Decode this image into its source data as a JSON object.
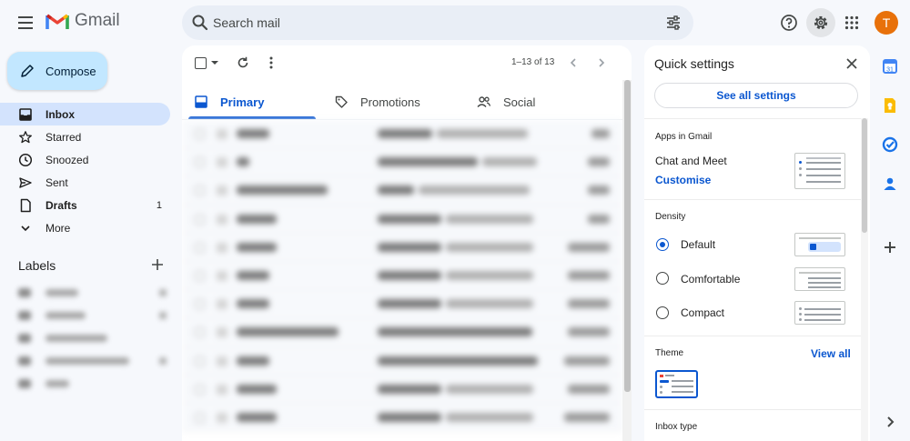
{
  "app": {
    "name": "Gmail"
  },
  "search": {
    "placeholder": "Search mail"
  },
  "account": {
    "initial": "T",
    "color": "#e8710a"
  },
  "colors": {
    "accent": "#0b57d0",
    "compose_bg": "#c2e7ff",
    "selected_nav": "#d3e3fd"
  },
  "compose": {
    "label": "Compose"
  },
  "nav": {
    "items": [
      {
        "label": "Inbox",
        "icon": "inbox-icon",
        "active": true
      },
      {
        "label": "Starred",
        "icon": "star-icon"
      },
      {
        "label": "Snoozed",
        "icon": "clock-icon"
      },
      {
        "label": "Sent",
        "icon": "send-icon"
      },
      {
        "label": "Drafts",
        "icon": "draft-icon",
        "count": "1"
      },
      {
        "label": "More",
        "icon": "chevron-down-icon"
      }
    ]
  },
  "labels": {
    "heading": "Labels"
  },
  "mail": {
    "pager": "1–13 of 13",
    "tabs": [
      {
        "label": "Primary",
        "icon": "inbox-tab-icon",
        "active": true
      },
      {
        "label": "Promotions",
        "icon": "tag-icon"
      },
      {
        "label": "Social",
        "icon": "people-icon"
      }
    ]
  },
  "quick_settings": {
    "title": "Quick settings",
    "see_all": "See all settings",
    "apps_heading": "Apps in Gmail",
    "apps_text": "Chat and Meet",
    "customise": "Customise",
    "density_heading": "Density",
    "density_options": [
      {
        "label": "Default",
        "selected": true
      },
      {
        "label": "Comfortable",
        "selected": false
      },
      {
        "label": "Compact",
        "selected": false
      }
    ],
    "theme_heading": "Theme",
    "view_all": "View all",
    "inbox_type_heading": "Inbox type"
  }
}
